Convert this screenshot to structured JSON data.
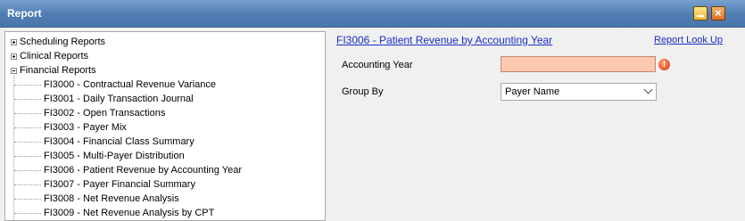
{
  "window": {
    "title": "Report"
  },
  "tree": {
    "categories": [
      {
        "label": "Scheduling Reports",
        "expanded": false
      },
      {
        "label": "Clinical Reports",
        "expanded": false
      },
      {
        "label": "Financial Reports",
        "expanded": true
      }
    ],
    "financial_items": [
      "FI3000 - Contractual Revenue Variance",
      "FI3001 - Daily Transaction Journal",
      "FI3002 - Open Transactions",
      "FI3003 - Payer Mix",
      "FI3004 - Financial Class Summary",
      "FI3005 - Multi-Payer Distribution",
      "FI3006 - Patient Revenue by Accounting Year",
      "FI3007 - Payer Financial Summary",
      "FI3008 - Net Revenue Analysis",
      "FI3009 - Net Revenue Analysis by CPT"
    ]
  },
  "panel": {
    "report_link": "FI3006 - Patient Revenue by Accounting Year",
    "lookup_link": "Report Look Up",
    "accounting_year_label": "Accounting Year",
    "accounting_year_value": "",
    "group_by_label": "Group By",
    "group_by_value": "Payer Name",
    "error_glyph": "!",
    "invalid_field_color": "#fbc9b0"
  }
}
